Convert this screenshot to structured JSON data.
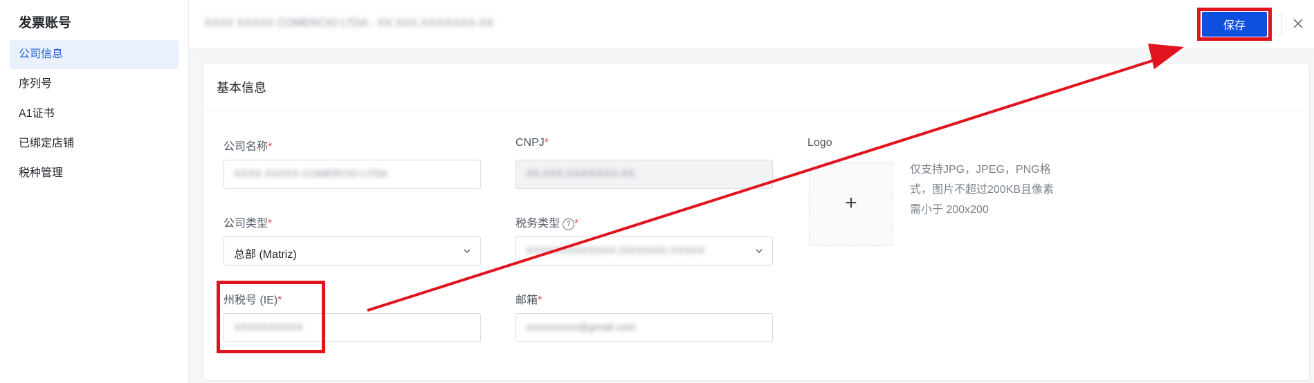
{
  "sidebar": {
    "title": "发票账号",
    "items": [
      {
        "label": "公司信息",
        "active": true
      },
      {
        "label": "序列号"
      },
      {
        "label": "A1证书"
      },
      {
        "label": "已绑定店铺"
      },
      {
        "label": "税种管理"
      }
    ]
  },
  "topbar": {
    "company_text_blurred": "XXXX XXXXX COMERCIO LTDA - XX.XXX.XXX/XXXX-XX",
    "save_label": "保存"
  },
  "card": {
    "title": "基本信息",
    "fields": {
      "company_name": {
        "label": "公司名称",
        "value_blurred": "XXXX XXXXX COMERCIO LTDA"
      },
      "cnpj": {
        "label": "CNPJ",
        "value_blurred": "XX.XXX.XXX/XXXX-XX"
      },
      "company_type": {
        "label": "公司类型",
        "value": "总部 (Matriz)"
      },
      "tax_type": {
        "label": "税务类型",
        "value_blurred": "XXXXXXXXXXXXX (XXXXXX) XXXXX"
      },
      "state_tax_no": {
        "label": "州税号 (IE)",
        "value_blurred": "XXXXXXXXXX"
      },
      "email": {
        "label": "邮箱",
        "value_blurred": "xxxxxxxxxx@gmail.com"
      },
      "logo": {
        "label": "Logo",
        "hint": "仅支持JPG，JPEG，PNG格式，图片不超过200KB且像素需小于 200x200",
        "plus": "+"
      }
    },
    "required_mark": "*",
    "help_glyph": "?"
  },
  "annotations": {
    "color": "#e0141e"
  },
  "colors": {
    "primary": "#0f4fe0",
    "active_nav_bg": "#e8f1fd",
    "active_nav_text": "#1b5fd1"
  }
}
